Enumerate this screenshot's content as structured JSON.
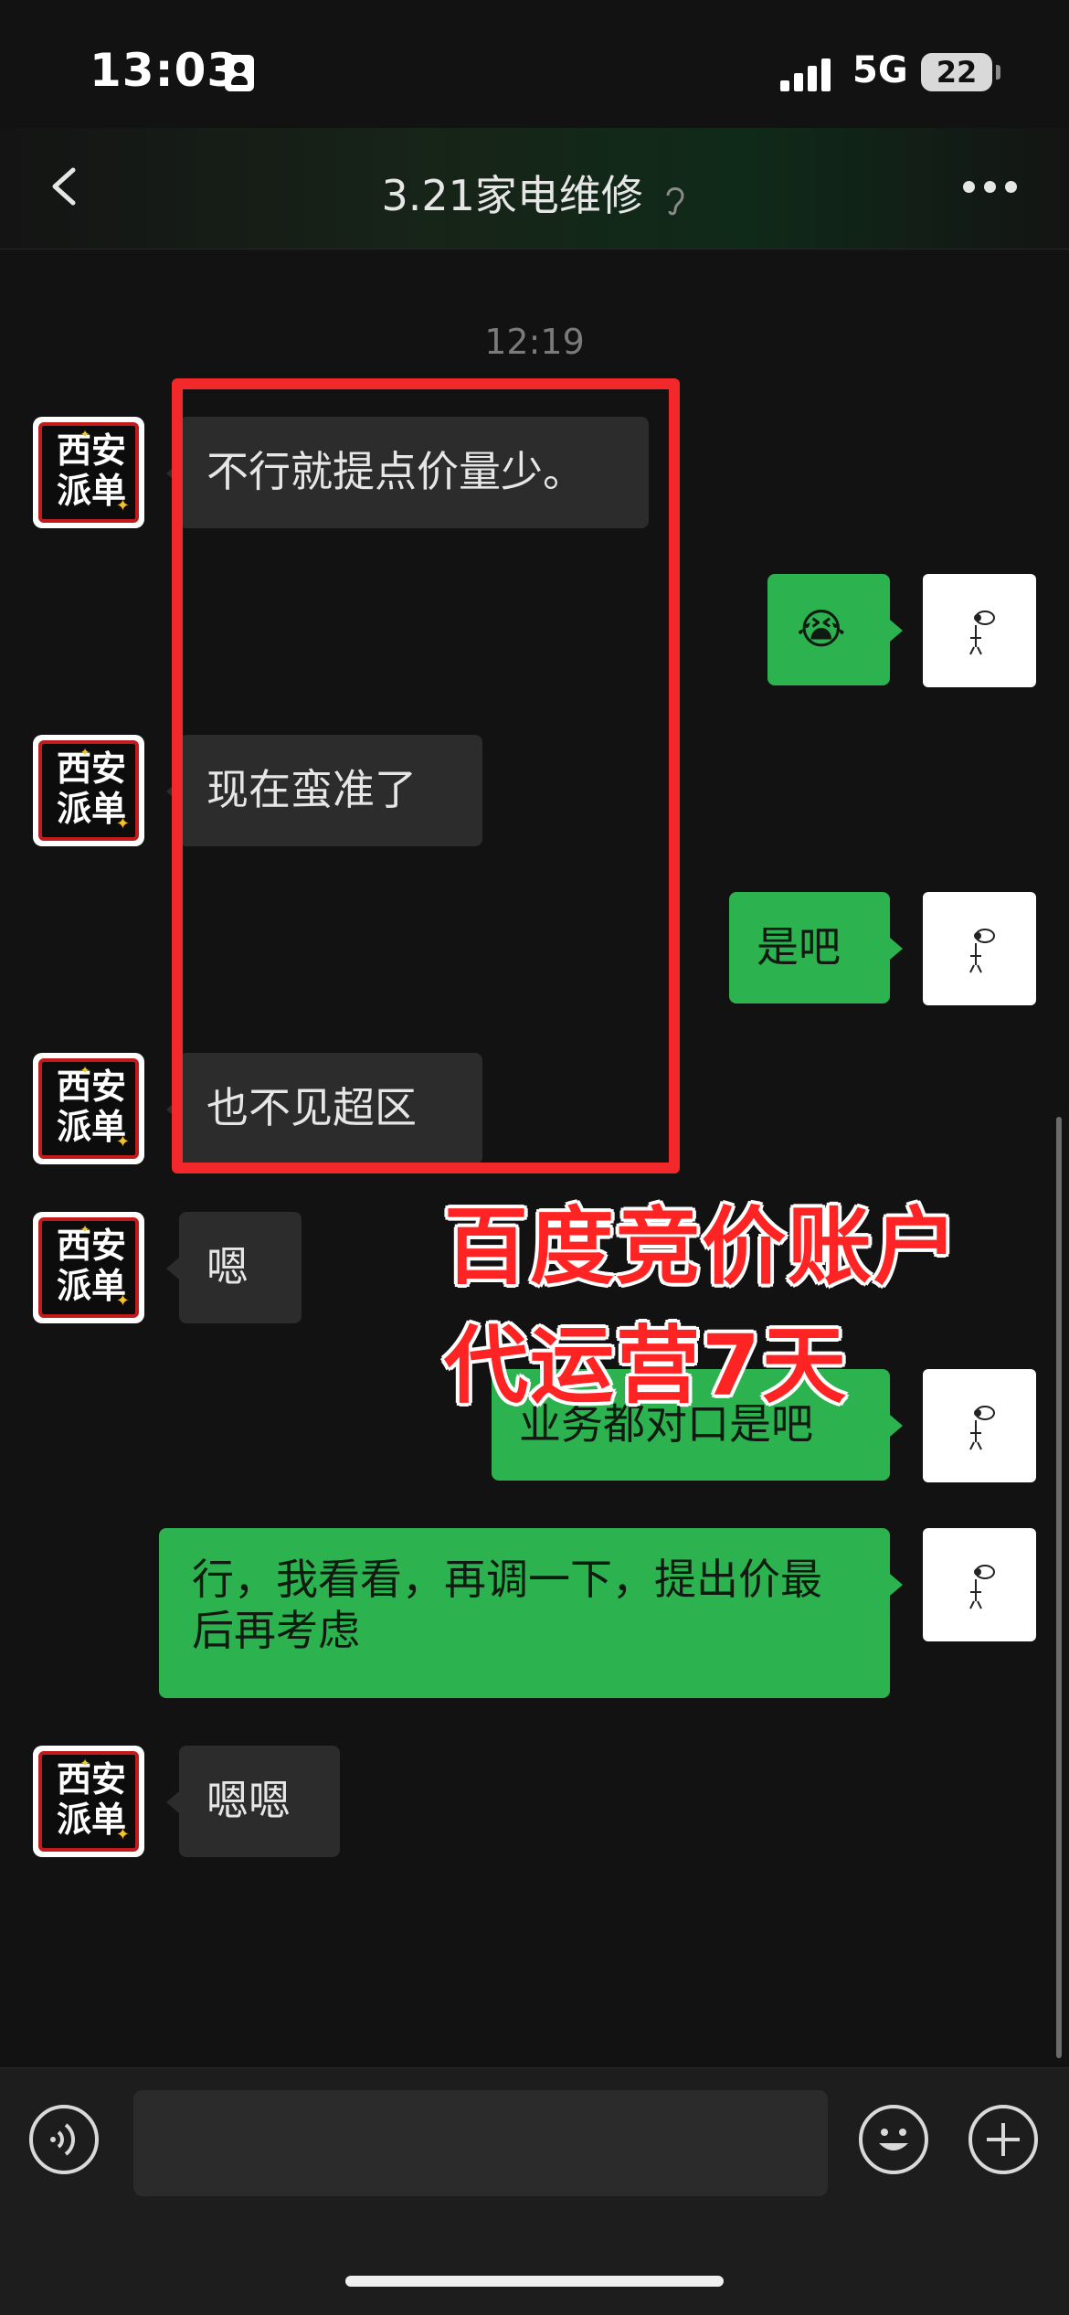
{
  "status_bar": {
    "time": "13:03",
    "network": "5G",
    "battery": "22"
  },
  "header": {
    "title": "3.21家电维修",
    "back_icon": "chevron-left-icon",
    "more_icon": "ellipsis-icon",
    "mute_icon": "ear-mute-icon"
  },
  "timestamp": "12:19",
  "contact_avatar": {
    "line1": "西安",
    "line2": "派单"
  },
  "messages": [
    {
      "side": "left",
      "text": "不行就提点价量少。"
    },
    {
      "side": "right",
      "text": "😭"
    },
    {
      "side": "left",
      "text": "现在蛮准了"
    },
    {
      "side": "right",
      "text": "是吧"
    },
    {
      "side": "left",
      "text": "也不见超区"
    },
    {
      "side": "left",
      "text": "嗯"
    },
    {
      "side": "right",
      "text": "业务都对口是吧"
    },
    {
      "side": "right",
      "text": "行，我看看，再调一下，提出价最后再考虑"
    },
    {
      "side": "left",
      "text": "嗯嗯"
    }
  ],
  "promo": {
    "line1": "百度竞价账户",
    "line2": "代运营7天"
  },
  "input_bar": {
    "placeholder": "",
    "voice_icon": "voice-icon",
    "emoji_icon": "emoji-icon",
    "plus_icon": "plus-icon"
  },
  "colors": {
    "background": "#121212",
    "incoming_bubble": "#2c2c2c",
    "outgoing_bubble": "#2cb24f",
    "highlight_red": "#f2282b"
  }
}
